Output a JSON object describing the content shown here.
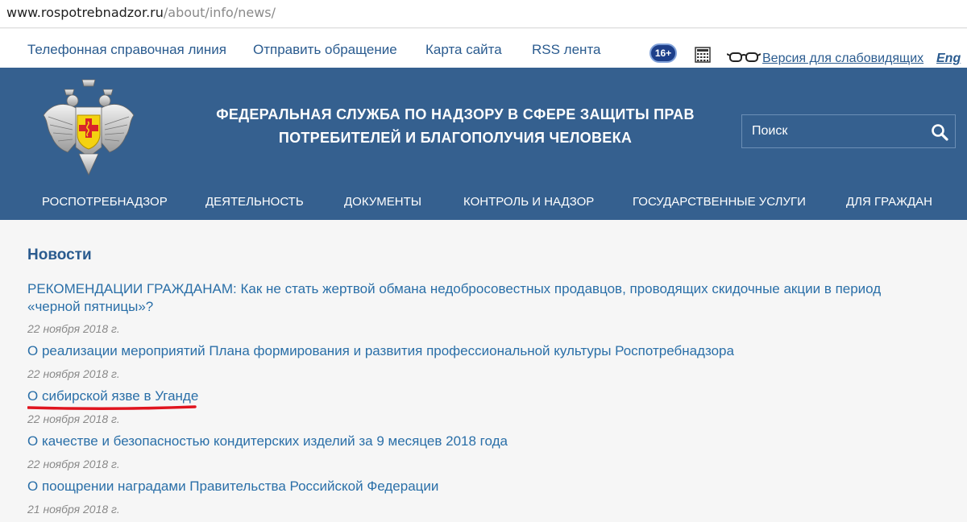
{
  "browser": {
    "url_host": "www.rospotrebnadzor.ru",
    "url_path": "/about/info/news/"
  },
  "utility_nav": {
    "items": [
      "Телефонная справочная линия",
      "Отправить обращение",
      "Карта сайта",
      "RSS лента"
    ],
    "age_rating": "16+",
    "vision_version": "Версия для слабовидящих",
    "language": "Eng"
  },
  "header": {
    "title_line1": "ФЕДЕРАЛЬНАЯ СЛУЖБА ПО НАДЗОРУ В СФЕРЕ ЗАЩИТЫ ПРАВ",
    "title_line2": "ПОТРЕБИТЕЛЕЙ И БЛАГОПОЛУЧИЯ ЧЕЛОВЕКА",
    "search_placeholder": "Поиск"
  },
  "main_nav": {
    "items": [
      "РОСПОТРЕБНАДЗОР",
      "ДЕЯТЕЛЬНОСТЬ",
      "ДОКУМЕНТЫ",
      "КОНТРОЛЬ И НАДЗОР",
      "ГОСУДАРСТВЕННЫЕ УСЛУГИ",
      "ДЛЯ ГРАЖДАН"
    ]
  },
  "news": {
    "title": "Новости",
    "items": [
      {
        "title": "РЕКОМЕНДАЦИИ ГРАЖДАНАМ: Как не стать жертвой обмана недобросовестных продавцов, проводящих скидочные акции в период «черной пятницы»?",
        "date": "22 ноября 2018 г."
      },
      {
        "title": "О реализации мероприятий Плана формирования и развития профессиональной культуры Роспотребнадзора",
        "date": "22 ноября 2018 г."
      },
      {
        "title": "О сибирской язве в Уганде",
        "date": "22 ноября 2018 г."
      },
      {
        "title": "О качестве и безопасностью кондитерских изделий за 9 месяцев 2018 года",
        "date": "22 ноября 2018 г."
      },
      {
        "title": "О поощрении наградами Правительства Российской Федерации",
        "date": "21 ноября 2018 г."
      }
    ]
  },
  "colors": {
    "header_bg": "#35608f",
    "link": "#2a6fa8",
    "highlight_underline": "#e0141e"
  }
}
